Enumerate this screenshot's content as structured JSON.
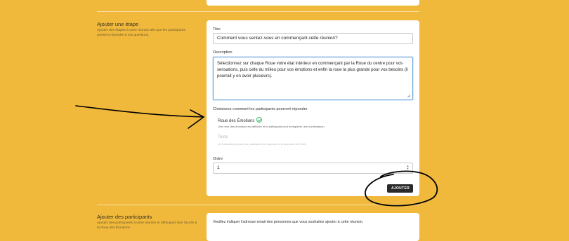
{
  "step_section": {
    "title": "Ajouter une étape",
    "description": "Ajoutez des étapes à votre réunion afin que les participants puissent répondre à vos questions.",
    "form": {
      "title_label": "Titre",
      "title_value": "Comment vous sentez-vous en commençant cette réunion?",
      "description_label": "Description",
      "description_value": "Sélectionnez sur chaque Roue votre état intérieur en commençant par la Roue du centre pour vos sensations, puis celle du milieu pour vos émotions et enfin la roue la plus grande pour vos besoins (il pourrait y en avoir plusieurs).",
      "type_label": "Choisissez comment les participants pourront répondre",
      "options": [
        {
          "title": "Roue des Émotions",
          "desc": "Une roue des émotions est affichée et le participant peut enregistrer une combinaison.",
          "selected": true
        },
        {
          "title": "Texte",
          "desc": "Un formulaire permet au participant de répondre à la question de l'écrit.",
          "selected": false
        }
      ],
      "order_label": "Ordre",
      "order_value": "1",
      "submit_label": "AJOUTER"
    }
  },
  "participants_section": {
    "title": "Ajouter des participants",
    "description": "Ajoutez des participants à votre réunion et débloquez leur l'accès à la Roue des Émotions.",
    "hint": "Veuillez indiquer l'adresse email des personnes que vous souhaitez ajouter à cette réunion."
  },
  "colors": {
    "background": "#f0b93c",
    "button": "#2a2a2a",
    "focus_border": "#6aa6dc",
    "check": "#3cb371",
    "annotation_ink": "#000000"
  }
}
